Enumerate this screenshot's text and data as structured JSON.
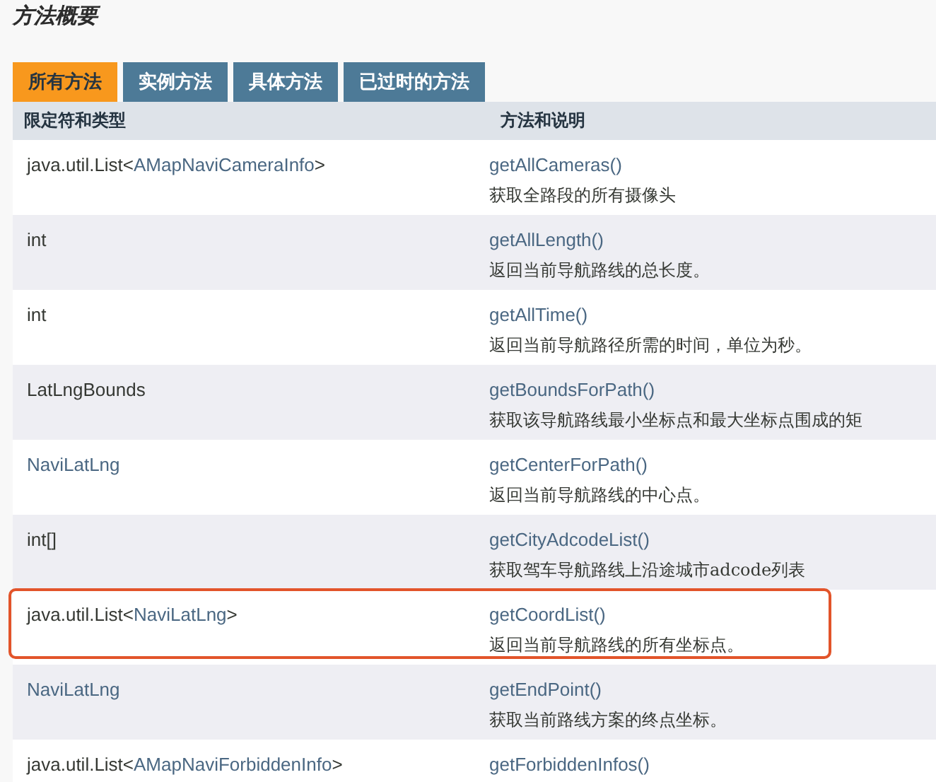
{
  "title": "方法概要",
  "tabs": [
    {
      "label": "所有方法",
      "selected": true
    },
    {
      "label": "实例方法",
      "selected": false
    },
    {
      "label": "具体方法",
      "selected": false
    },
    {
      "label": "已过时的方法",
      "selected": false
    }
  ],
  "table": {
    "columns": [
      "限定符和类型",
      "方法和说明"
    ],
    "rows": [
      {
        "type": [
          {
            "text": "java.util.List<",
            "kind": "plain"
          },
          {
            "text": "AMapNaviCameraInfo",
            "kind": "link"
          },
          {
            "text": ">",
            "kind": "plain"
          }
        ],
        "method": "getAllCameras()",
        "description": "获取全路段的所有摄像头",
        "highlighted": false
      },
      {
        "type": [
          {
            "text": "int",
            "kind": "plain"
          }
        ],
        "method": "getAllLength()",
        "description": "返回当前导航路线的总长度。",
        "highlighted": false
      },
      {
        "type": [
          {
            "text": "int",
            "kind": "plain"
          }
        ],
        "method": "getAllTime()",
        "description": "返回当前导航路径所需的时间，单位为秒。",
        "highlighted": false
      },
      {
        "type": [
          {
            "text": "LatLngBounds",
            "kind": "plain"
          }
        ],
        "method": "getBoundsForPath()",
        "description": "获取该导航路线最小坐标点和最大坐标点围成的矩",
        "highlighted": false
      },
      {
        "type": [
          {
            "text": "NaviLatLng",
            "kind": "link"
          }
        ],
        "method": "getCenterForPath()",
        "description": "返回当前导航路线的中心点。",
        "highlighted": false
      },
      {
        "type": [
          {
            "text": "int[]",
            "kind": "plain"
          }
        ],
        "method": "getCityAdcodeList()",
        "description": "获取驾车导航路线上沿途城市adcode列表",
        "highlighted": false
      },
      {
        "type": [
          {
            "text": "java.util.List<",
            "kind": "plain"
          },
          {
            "text": "NaviLatLng",
            "kind": "link"
          },
          {
            "text": ">",
            "kind": "plain"
          }
        ],
        "method": "getCoordList()",
        "description": "返回当前导航路线的所有坐标点。",
        "highlighted": true
      },
      {
        "type": [
          {
            "text": "NaviLatLng",
            "kind": "link"
          }
        ],
        "method": "getEndPoint()",
        "description": "获取当前路线方案的终点坐标。",
        "highlighted": false
      },
      {
        "type": [
          {
            "text": "java.util.List<",
            "kind": "plain"
          },
          {
            "text": "AMapNaviForbiddenInfo",
            "kind": "link"
          },
          {
            "text": ">",
            "kind": "plain"
          }
        ],
        "method": "getForbiddenInfos()",
        "highlighted": false
      }
    ]
  }
}
